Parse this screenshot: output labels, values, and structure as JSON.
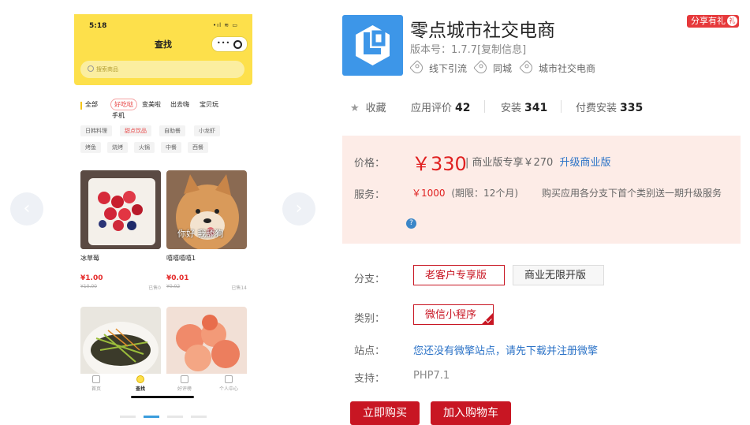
{
  "gallery": {
    "phone": {
      "time": "5:18",
      "status": "•ıl ≋ ▭",
      "title": "查找",
      "capsule_dots": "•••",
      "search_placeholder": "搜索商品",
      "categories": [
        "全部",
        "好吃哒",
        "变美啦",
        "出去嗨",
        "宝贝玩",
        "手机"
      ],
      "tags_row1": [
        "日韩料理",
        "甜点饮品",
        "自助餐",
        "小龙虾"
      ],
      "tags_row2": [
        "烤鱼",
        "烧烤",
        "火锅",
        "中餐",
        "西餐"
      ],
      "products": [
        {
          "name": "冰草莓",
          "price": "¥1.00",
          "old_price": "¥10.00",
          "sold": "已售0"
        },
        {
          "name": "嘻嘻嘻嘻1",
          "price": "¥0.01",
          "old_price": "¥0.02",
          "sold": "已售14",
          "overlay": "你好 我舔狗"
        }
      ],
      "tabs": [
        "首页",
        "查找",
        "好评榜",
        "个人中心"
      ]
    },
    "prev_icon": "‹",
    "next_icon": "›"
  },
  "app": {
    "title": "零点城市社交电商",
    "version": "版本号：1.7.7[复制信息]",
    "tags": [
      "线下引流",
      "同城",
      "城市社交电商"
    ],
    "share": {
      "label": "分享有礼",
      "gift_glyph": "礼"
    }
  },
  "stats": {
    "favorite_icon": "★",
    "favorite": "收藏",
    "rating_label": "应用评价",
    "rating_count": "42",
    "install_label": "安装",
    "install_count": "341",
    "paid_label": "付费安装",
    "paid_count": "335"
  },
  "pricing": {
    "price_label": "价格：",
    "price": "￥330",
    "biz_text": "| 商业版专享￥270",
    "upgrade_link": "升级商业版",
    "service_label": "服务：",
    "service_price": "￥1000",
    "service_term": "(期限：12个月)",
    "service_note": "购买应用各分支下首个类别送一期升级服务",
    "help_icon": "?"
  },
  "options": {
    "branch_label": "分支：",
    "branches": [
      "老客户专享版",
      "商业无限开版"
    ],
    "category_label": "类别：",
    "category": "微信小程序",
    "station_label": "站点：",
    "station_text": "您还没有微擎站点，请先下载并注册微擎",
    "support_label": "支持：",
    "support_value": "PHP7.1"
  },
  "actions": {
    "buy_now": "立即购买",
    "add_cart": "加入购物车"
  },
  "colors": {
    "accent_red": "#c81623",
    "price_red": "#e02020",
    "link_blue": "#2c73c7",
    "phone_yellow": "#fde04b",
    "icon_blue": "#3d96e8"
  }
}
